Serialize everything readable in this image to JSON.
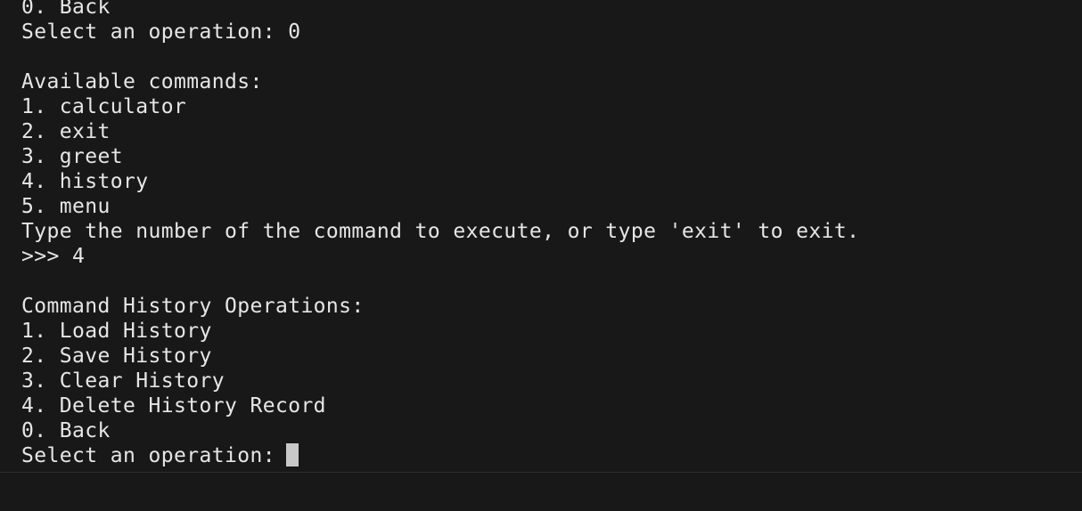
{
  "terminal": {
    "lines": [
      "0. Back",
      "Select an operation: 0",
      "",
      "Available commands:",
      "1. calculator",
      "2. exit",
      "3. greet",
      "4. history",
      "5. menu",
      "Type the number of the command to execute, or type 'exit' to exit.",
      ">>> 4",
      "",
      "Command History Operations:",
      "1. Load History",
      "2. Save History",
      "3. Clear History",
      "4. Delete History Record",
      "0. Back"
    ],
    "prompt": "Select an operation:"
  },
  "colors": {
    "background": "#181818",
    "text": "#e6e6e6",
    "cursor": "#c8c8c8"
  }
}
